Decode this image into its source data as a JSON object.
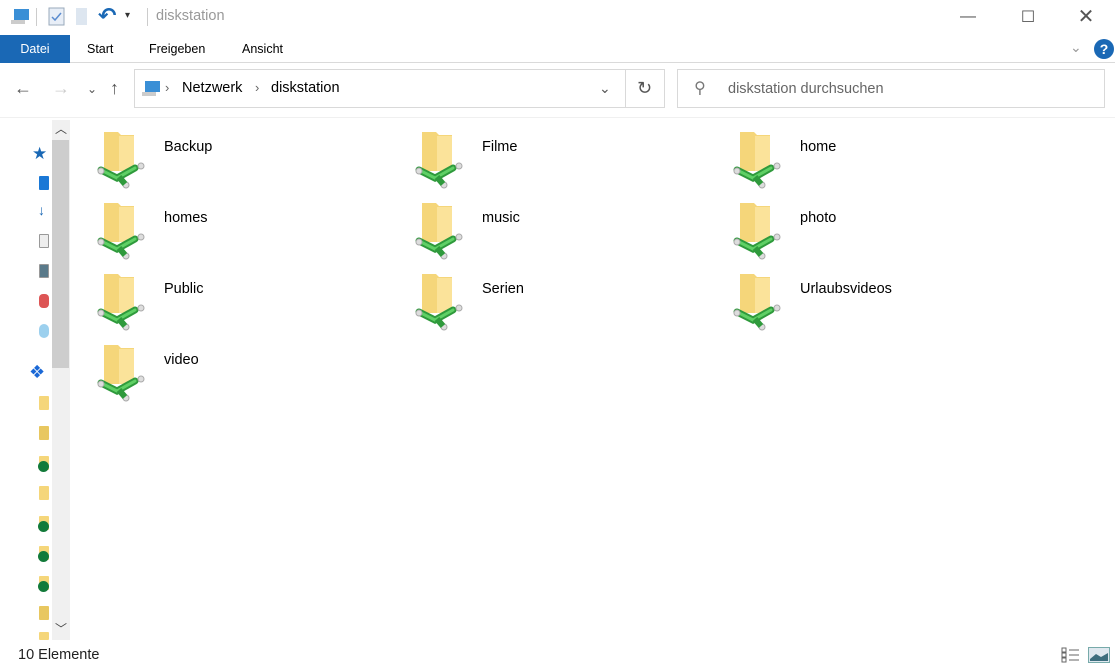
{
  "window": {
    "title": "diskstation"
  },
  "ribbon": {
    "tabs": [
      "Datei",
      "Start",
      "Freigeben",
      "Ansicht"
    ],
    "help_label": "?"
  },
  "address": {
    "crumbs": [
      "Netzwerk",
      "diskstation"
    ]
  },
  "search": {
    "placeholder": "diskstation durchsuchen"
  },
  "items": [
    {
      "name": "Backup"
    },
    {
      "name": "Filme"
    },
    {
      "name": "home"
    },
    {
      "name": "homes"
    },
    {
      "name": "music"
    },
    {
      "name": "photo"
    },
    {
      "name": "Public"
    },
    {
      "name": "Serien"
    },
    {
      "name": "Urlaubsvideos"
    },
    {
      "name": "video"
    }
  ],
  "status": {
    "count": "10 Elemente"
  },
  "colors": {
    "accent": "#1a68b5",
    "folder": "#f5d67a",
    "pipe": "#3cb34a"
  }
}
